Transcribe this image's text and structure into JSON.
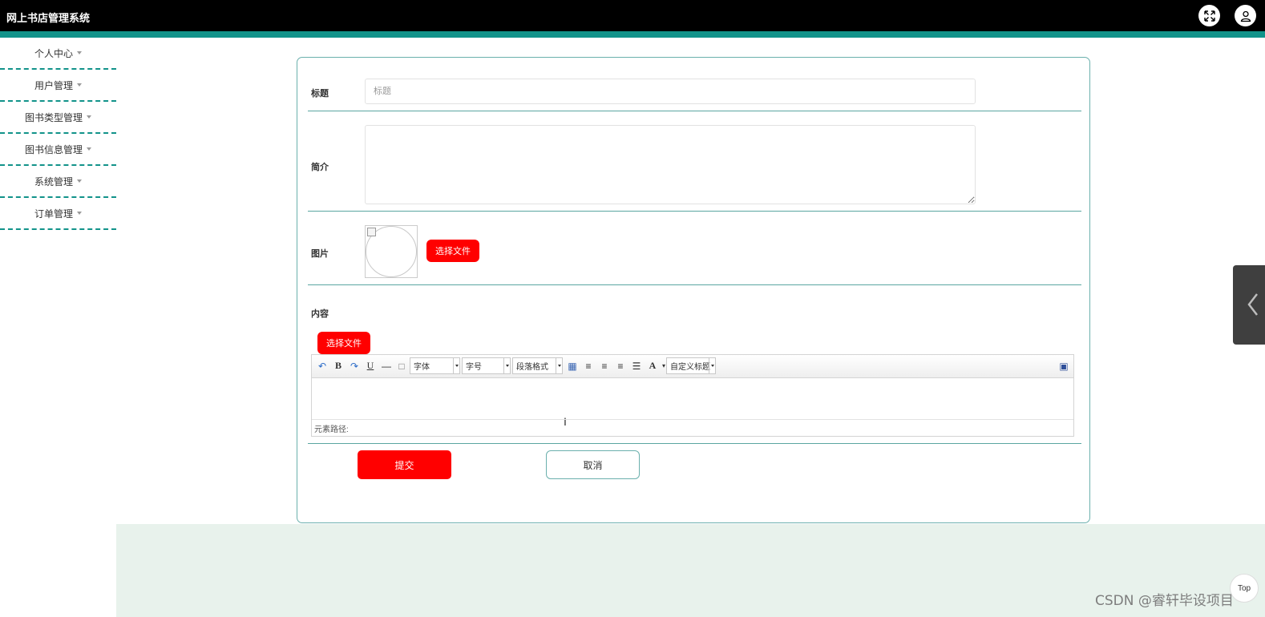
{
  "header": {
    "title": "网上书店管理系统",
    "fullscreen_icon": "fullscreen-icon",
    "user_icon": "user-icon"
  },
  "sidebar": {
    "items": [
      {
        "label": "个人中心"
      },
      {
        "label": "用户管理"
      },
      {
        "label": "图书类型管理"
      },
      {
        "label": "图书信息管理"
      },
      {
        "label": "系统管理"
      },
      {
        "label": "订单管理"
      }
    ]
  },
  "form": {
    "title_label": "标题",
    "title_placeholder": "标题",
    "title_value": "",
    "intro_label": "简介",
    "intro_value": "",
    "image_label": "图片",
    "image_choose_label": "选择文件",
    "content_label": "内容",
    "content_choose_label": "选择文件",
    "submit_label": "提交",
    "cancel_label": "取消"
  },
  "editor": {
    "font_select": "字体",
    "size_select": "字号",
    "paragraph_select": "段落格式",
    "custom_title_select": "自定义标题",
    "element_path": "元素路径:"
  },
  "misc": {
    "top_button": "Top",
    "watermark": "CSDN @睿轩毕设项目"
  },
  "colors": {
    "accent": "#12938a",
    "primary_button": "#ff0000",
    "header_bg": "#000000",
    "footer_bg": "#e8f2ec"
  }
}
